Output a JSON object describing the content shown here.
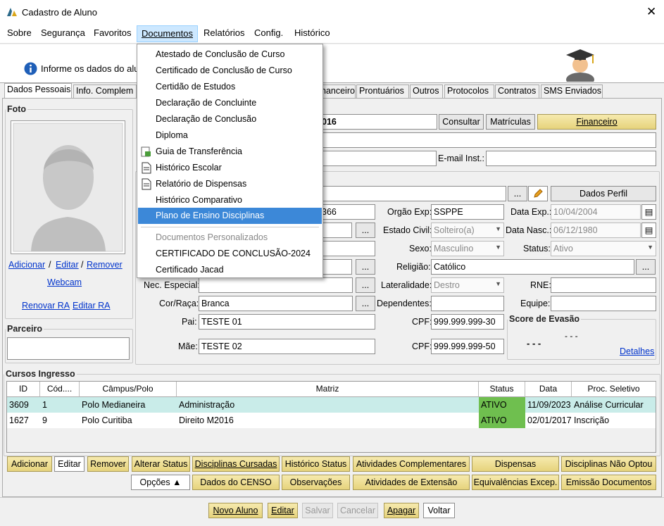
{
  "window": {
    "title": "Cadastro de Aluno",
    "close_icon": "close-icon",
    "logo_icon": "app-logo-icon"
  },
  "menu": {
    "items": [
      "Sobre",
      "Segurança",
      "Favoritos",
      "Documentos",
      "Relatórios",
      "Config.",
      "Histórico"
    ]
  },
  "info": {
    "text": "Informe os dados do alu"
  },
  "tabs": [
    "Dados Pessoais",
    "Info. Complem",
    "nanceiro",
    "Prontuários",
    "Outros",
    "Protocolos",
    "Contratos",
    "SMS Enviados"
  ],
  "foto": {
    "legend": "Foto",
    "adicionar": "Adicionar",
    "sep1": "/",
    "editar": "Editar",
    "sep2": "/",
    "remover": "Remover",
    "webcam": "Webcam",
    "renovar_ra": "Renovar RA",
    "editar_ra": "Editar RA"
  },
  "parceiro": {
    "legend": "Parceiro"
  },
  "top": {
    "ra_value": "016",
    "consultar": "Consultar",
    "matriculas": "Matrículas",
    "financeiro": "Financeiro",
    "email_inst_label": "E-mail Inst.:"
  },
  "perfil": {
    "ellipsis": "...",
    "dados_perfil": "Dados Perfil"
  },
  "form": {
    "rg_value": "366",
    "orgao_label": "Orgão Exp:",
    "orgao_value": "SSPPE",
    "data_exp_label": "Data Exp.:",
    "data_exp_value": "10/04/2004",
    "estado_civil_label": "Estado Civil:",
    "estado_civil_value": "Solteiro(a)",
    "data_nasc_label": "Data Nasc.:",
    "data_nasc_value": "06/12/1980",
    "sexo_label": "Sexo:",
    "sexo_value": "Masculino",
    "status_label": "Status:",
    "status_value": "Ativo",
    "religiao_label": "Religião:",
    "religiao_value": "Católico",
    "nec_label": "Nec. Especial:",
    "lateralidade_label": "Lateralidade:",
    "lateralidade_value": "Destro",
    "rne_label": "RNE:",
    "cor_label": "Cor/Raça:",
    "cor_value": "Branca",
    "dependentes_label": "Dependentes:",
    "equipe_label": "Equipe:",
    "pai_label": "Pai:",
    "pai_value": "TESTE 01",
    "cpf_label": "CPF:",
    "cpf_pai": "999.999.999-30",
    "mae_label": "Mãe:",
    "mae_value": "TESTE 02",
    "cpf_mae": "999.999.999-50"
  },
  "score": {
    "legend": "Score de Evasão",
    "dash1": "- - -",
    "dash2": "- - -",
    "detalhes": "Detalhes"
  },
  "cursos": {
    "legend": "Cursos Ingresso",
    "headers": [
      "ID",
      "Cód....",
      "Câmpus/Polo",
      "Matriz",
      "Status",
      "Data",
      "Proc. Seletivo"
    ],
    "rows": [
      [
        "3609",
        "1",
        "Polo Medianeira",
        "Administração",
        "ATIVO",
        "11/09/2023",
        "Análise Curricular"
      ],
      [
        "1627",
        "9",
        "Polo Curitiba",
        "Direito M2016",
        "ATIVO",
        "02/01/2017",
        "Inscrição"
      ]
    ]
  },
  "row_buttons_1": [
    "Adicionar",
    "Editar",
    "Remover",
    "Alterar Status",
    "Disciplinas Cursadas",
    "Histórico Status",
    "Atividades Complementares",
    "Dispensas",
    "Disciplinas Não Optou"
  ],
  "row_buttons_2": [
    "Opções ▲",
    "Dados do CENSO",
    "Observações",
    "Atividades de Extensão",
    "Equivalências Excep.",
    "Emissão Documentos"
  ],
  "footer_buttons": [
    "Novo Aluno",
    "Editar",
    "Salvar",
    "Cancelar",
    "Apagar",
    "Voltar"
  ],
  "dropdown": {
    "items": [
      "Atestado de Conclusão de Curso",
      "Certificado de Conclusão de Curso",
      "Certidão de Estudos",
      "Declaração de Concluinte",
      "Declaração de Conclusão",
      "Diploma",
      "Guia de Transferência",
      "Histórico Escolar",
      "Relatório de Dispensas",
      "Histórico Comparativo",
      "Plano de Ensino Disciplinas"
    ],
    "group_label": "Documentos Personalizados",
    "custom_items": [
      "CERTIFICADO DE CONCLUSÃO-2024",
      "Certificado Jacad"
    ]
  },
  "colors": {
    "accent": "#3c88d8",
    "gold": "#e6d37c",
    "active_status": "#6fbf4f",
    "row_highlight": "#c9ece9"
  }
}
